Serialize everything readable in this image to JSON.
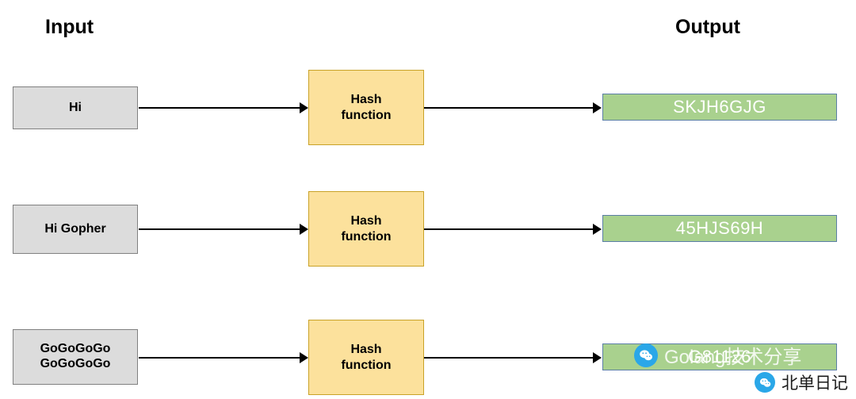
{
  "headings": {
    "input": "Input",
    "output": "Output"
  },
  "rows": [
    {
      "input": "Hi",
      "hash": "Hash\nfunction",
      "hash_line1": "Hash",
      "hash_line2": "function",
      "output": "SKJH6GJG"
    },
    {
      "input": "Hi Gopher",
      "hash_line1": "Hash",
      "hash_line2": "function",
      "output": "45HJS69H"
    },
    {
      "input_line1": "GoGoGoGo",
      "input_line2": "GoGoGoGo",
      "hash_line1": "Hash",
      "hash_line2": "function",
      "output": "G81126"
    }
  ],
  "watermarks": {
    "center": "Golang技术分享",
    "corner": "北单日记"
  },
  "colors": {
    "input_fill": "#dcdcdc",
    "input_border": "#808080",
    "hash_fill": "#fce19c",
    "hash_border": "#c9a227",
    "output_fill": "#a9d18e",
    "output_border": "#5b7fa6",
    "arrow": "#000000",
    "badge": "#2aa7e8"
  }
}
